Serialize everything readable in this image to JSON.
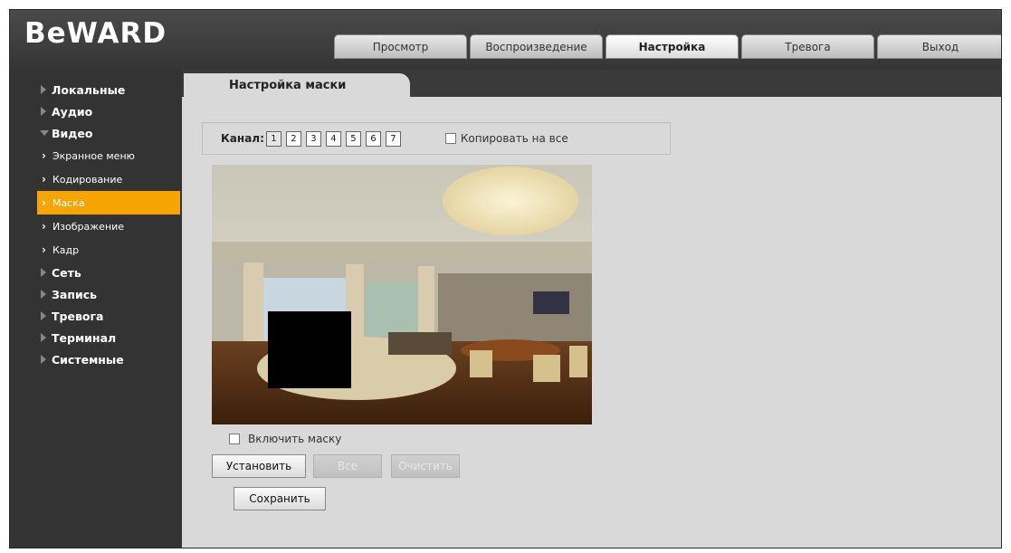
{
  "app": {
    "logo": "BeWARD"
  },
  "tabs": [
    {
      "label": "Просмотр",
      "active": false
    },
    {
      "label": "Воспроизведение",
      "active": false
    },
    {
      "label": "Настройка",
      "active": true
    },
    {
      "label": "Тревога",
      "active": false
    },
    {
      "label": "Выход",
      "active": false
    }
  ],
  "sidebar": {
    "items": [
      {
        "label": "Локальные"
      },
      {
        "label": "Аудио"
      },
      {
        "label": "Видео",
        "expanded": true,
        "children": [
          {
            "label": "Экранное меню"
          },
          {
            "label": "Кодирование"
          },
          {
            "label": "Маска",
            "active": true
          },
          {
            "label": "Изображение"
          },
          {
            "label": "Кадр"
          }
        ]
      },
      {
        "label": "Сеть"
      },
      {
        "label": "Запись"
      },
      {
        "label": "Тревога"
      },
      {
        "label": "Терминал"
      },
      {
        "label": "Системные"
      }
    ]
  },
  "page": {
    "title": "Настройка маски",
    "channel_label": "Канал:",
    "channels": [
      "1",
      "2",
      "3",
      "4",
      "5",
      "6",
      "7"
    ],
    "selected_channel": "1",
    "copy_all_label": "Копировать на все",
    "copy_all_checked": false,
    "enable_mask_label": "Включить маску",
    "enable_mask_checked": false,
    "buttons": {
      "set": "Установить",
      "all": "Все",
      "clear": "Очистить",
      "save": "Сохранить"
    },
    "buttons_disabled": [
      "all",
      "clear"
    ]
  },
  "colors": {
    "accent": "#f5a400",
    "sidebar_bg": "#333333",
    "content_bg": "#d9d9d9"
  }
}
